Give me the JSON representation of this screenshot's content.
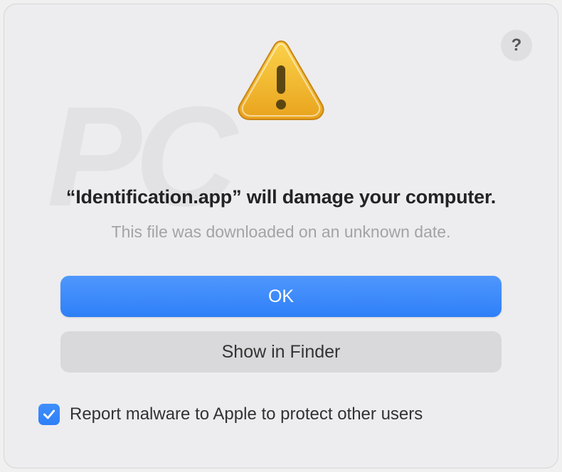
{
  "dialog": {
    "title": "“Identification.app” will damage your computer.",
    "subtitle": "This file was downloaded on an unknown date.",
    "primary_button": "OK",
    "secondary_button": "Show in Finder",
    "checkbox_label": "Report malware to Apple to protect other users",
    "checkbox_checked": true,
    "help_button_label": "?"
  }
}
